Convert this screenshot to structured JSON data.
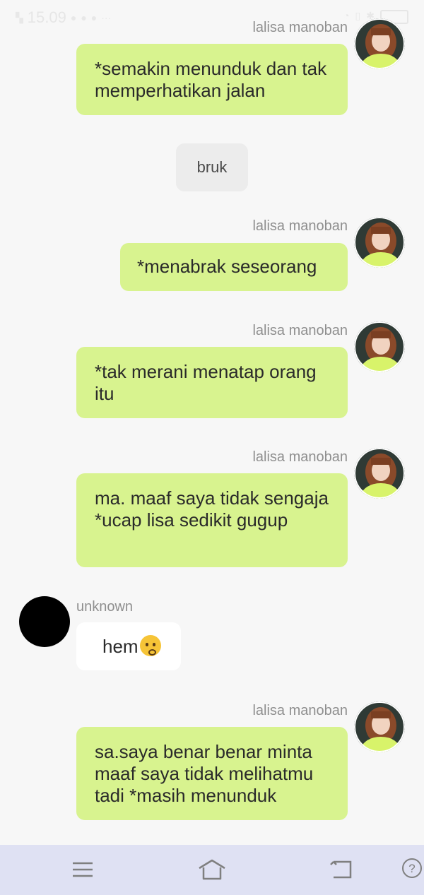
{
  "status_bar": {
    "time": "15.09"
  },
  "messages": [
    {
      "type": "outgoing",
      "sender": "lalisa manoban",
      "text": "*semakin menunduk dan tak memperhatikan jalan"
    },
    {
      "type": "system",
      "text": "bruk"
    },
    {
      "type": "outgoing",
      "sender": "lalisa manoban",
      "text": "*menabrak seseorang"
    },
    {
      "type": "outgoing",
      "sender": "lalisa manoban",
      "text": "*tak merani menatap orang itu"
    },
    {
      "type": "outgoing",
      "sender": "lalisa manoban",
      "text": "ma. maaf saya tidak sengaja *ucap lisa sedikit gugup"
    },
    {
      "type": "incoming",
      "sender": "unknown",
      "text": "hem"
    },
    {
      "type": "outgoing",
      "sender": "lalisa manoban",
      "text": "sa.saya benar benar minta maaf saya tidak melihatmu tadi *masih menunduk"
    }
  ],
  "nav": {
    "menu_icon": "menu-icon",
    "home_icon": "home-icon",
    "back_icon": "back-icon",
    "help_icon": "help-icon"
  },
  "colors": {
    "outgoing_bubble": "#d8f38f",
    "incoming_bubble": "#ffffff",
    "system_bubble": "#ececec",
    "background": "#f7f7f7",
    "nav_bar": "#dfe1f3"
  }
}
